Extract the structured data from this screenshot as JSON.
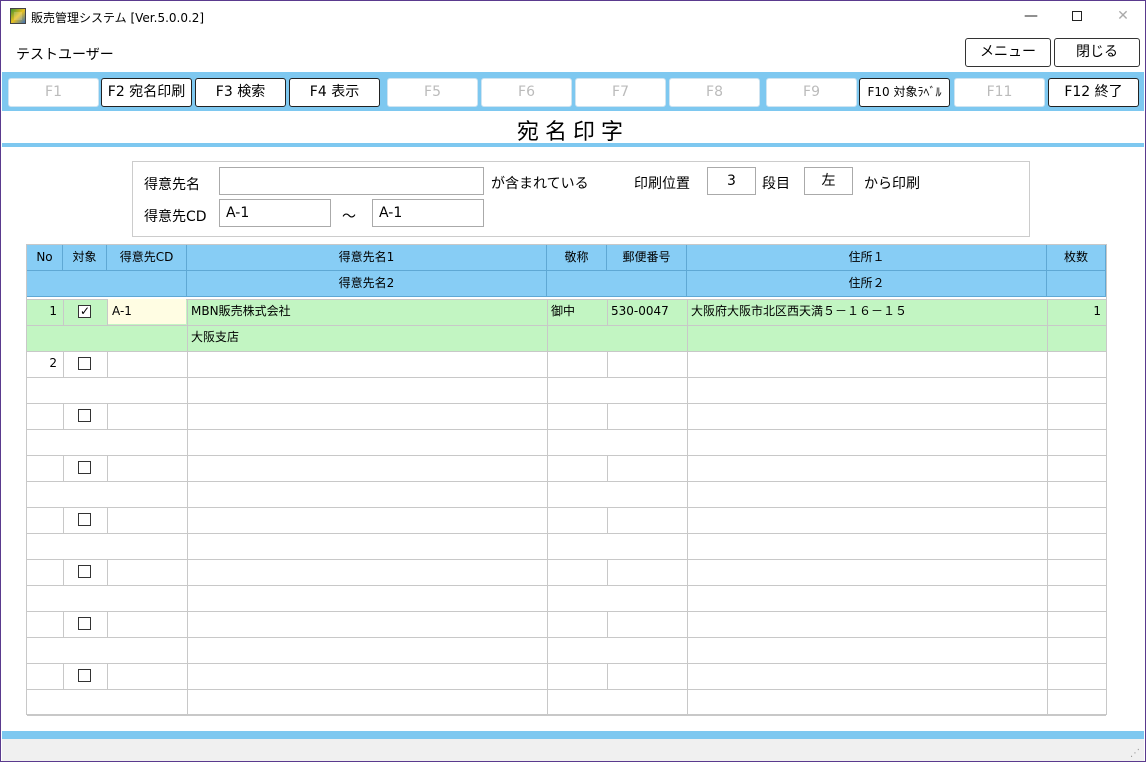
{
  "window": {
    "title": "販売管理システム [Ver.5.0.0.2]",
    "controls": {
      "minimize": "—",
      "close": "✕"
    }
  },
  "header": {
    "user": "テストユーザー",
    "menu_label": "メニュー",
    "close_label": "閉じる"
  },
  "fkeys": [
    {
      "label": "F1",
      "enabled": false
    },
    {
      "label": "F2 宛名印刷",
      "enabled": true
    },
    {
      "label": "F3 検索",
      "enabled": true
    },
    {
      "label": "F4 表示",
      "enabled": true
    },
    {
      "label": "F5",
      "enabled": false
    },
    {
      "label": "F6",
      "enabled": false
    },
    {
      "label": "F7",
      "enabled": false
    },
    {
      "label": "F8",
      "enabled": false
    },
    {
      "label": "F9",
      "enabled": false
    },
    {
      "label": "F10 対象ﾗﾍﾞﾙ",
      "enabled": true
    },
    {
      "label": "F11",
      "enabled": false
    },
    {
      "label": "F12 終了",
      "enabled": true
    }
  ],
  "page": {
    "title": "宛名印字"
  },
  "search": {
    "customer_name_label": "得意先名",
    "customer_name_value": "",
    "contains_label": "が含まれている",
    "print_pos_label": "印刷位置",
    "print_pos_value": "3",
    "row_label": "段目",
    "side_value": "左",
    "from_label": "から印刷",
    "customer_cd_label": "得意先CD",
    "cd_from": "A-1",
    "tilde": "～",
    "cd_to": "A-1"
  },
  "grid": {
    "headers_row1": {
      "no": "No",
      "target": "対象",
      "cd": "得意先CD",
      "name1": "得意先名1",
      "honorific": "敬称",
      "zip": "郵便番号",
      "address1": "住所１",
      "count": "枚数"
    },
    "headers_row2": {
      "name2": "得意先名2",
      "address2": "住所２"
    },
    "rows": [
      {
        "no": "1",
        "checked": true,
        "cd": "A-1",
        "name1": "MBN販売株式会社",
        "name2": "大阪支店",
        "honorific": "御中",
        "zip": "530-0047",
        "address1": "大阪府大阪市北区西天満５－１６－１５",
        "address2": "",
        "count": "1"
      },
      {
        "no": "2",
        "checked": false,
        "cd": "",
        "name1": "",
        "name2": "",
        "honorific": "",
        "zip": "",
        "address1": "",
        "address2": "",
        "count": ""
      },
      {
        "no": "",
        "checked": false,
        "cd": "",
        "name1": "",
        "name2": "",
        "honorific": "",
        "zip": "",
        "address1": "",
        "address2": "",
        "count": ""
      },
      {
        "no": "",
        "checked": false,
        "cd": "",
        "name1": "",
        "name2": "",
        "honorific": "",
        "zip": "",
        "address1": "",
        "address2": "",
        "count": ""
      },
      {
        "no": "",
        "checked": false,
        "cd": "",
        "name1": "",
        "name2": "",
        "honorific": "",
        "zip": "",
        "address1": "",
        "address2": "",
        "count": ""
      },
      {
        "no": "",
        "checked": false,
        "cd": "",
        "name1": "",
        "name2": "",
        "honorific": "",
        "zip": "",
        "address1": "",
        "address2": "",
        "count": ""
      },
      {
        "no": "",
        "checked": false,
        "cd": "",
        "name1": "",
        "name2": "",
        "honorific": "",
        "zip": "",
        "address1": "",
        "address2": "",
        "count": ""
      },
      {
        "no": "",
        "checked": false,
        "cd": "",
        "name1": "",
        "name2": "",
        "honorific": "",
        "zip": "",
        "address1": "",
        "address2": "",
        "count": ""
      }
    ]
  },
  "colors": {
    "accent": "#7ec8f0",
    "header_bg": "#87cdf5",
    "selected_row": "#c2f5c2",
    "edit_cell": "#fffde3"
  }
}
